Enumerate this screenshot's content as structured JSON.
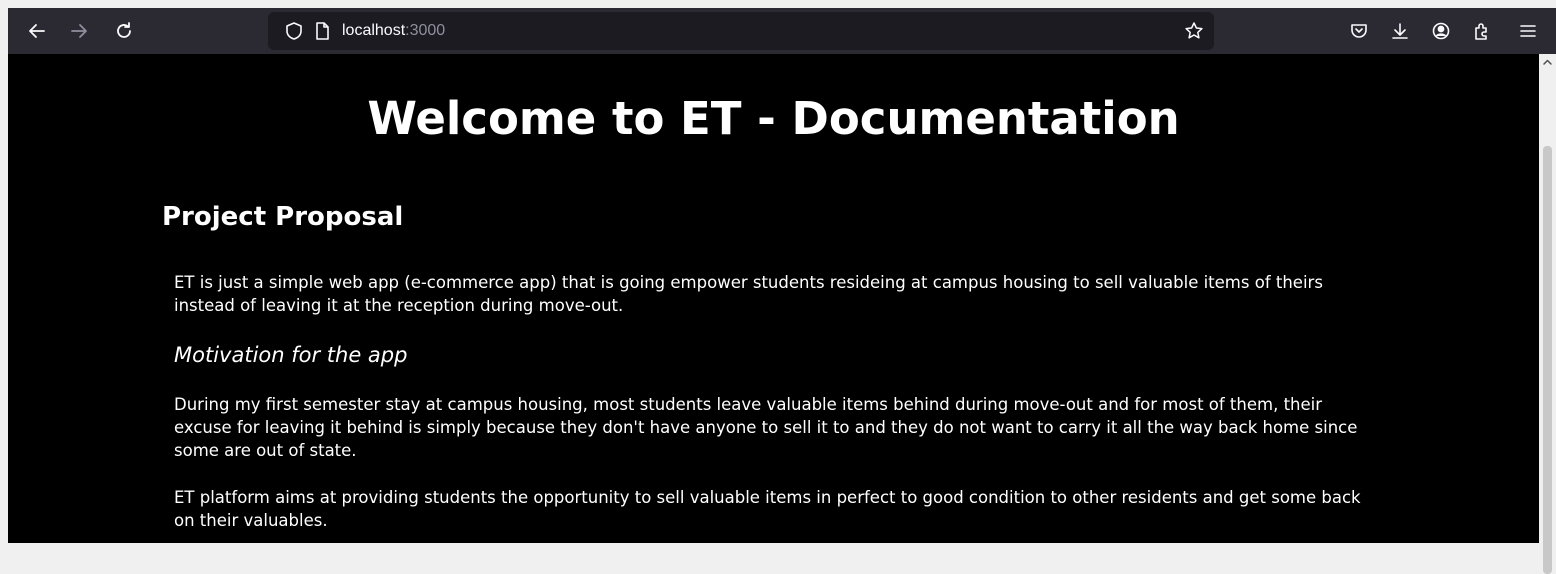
{
  "browser": {
    "url_host": "localhost",
    "url_port": ":3000",
    "icons": {
      "back": "arrow-left-icon",
      "forward": "arrow-right-icon",
      "reload": "reload-icon",
      "shield": "shield-icon",
      "page": "page-icon",
      "bookmark": "star-icon",
      "pocket": "pocket-icon",
      "downloads": "download-icon",
      "account": "account-icon",
      "extensions": "extensions-icon",
      "menu": "hamburger-menu-icon"
    },
    "colors": {
      "toolbar": "#2b2a33",
      "urlbar": "#1c1b22",
      "content_background": "#000000",
      "content_text": "#ffffff"
    }
  },
  "page": {
    "title": "Welcome to ET - Documentation",
    "section_heading": "Project Proposal",
    "intro": "ET is just a simple web app (e-commerce app) that is going empower students resideing at campus housing to sell valuable items of theirs instead of leaving it at the reception during move-out.",
    "motivation_heading": "Motivation for the app",
    "motivation_text": "During my first semester stay at campus housing, most students leave valuable items behind during move-out and for most of them, their excuse for leaving it behind is simply because they don't have anyone to sell it to and they do not want to carry it all the way back home since some are out of state.",
    "platform_text": "ET platform aims at providing students the opportunity to sell valuable items in perfect to good condition to other residents and get some back on their valuables."
  }
}
